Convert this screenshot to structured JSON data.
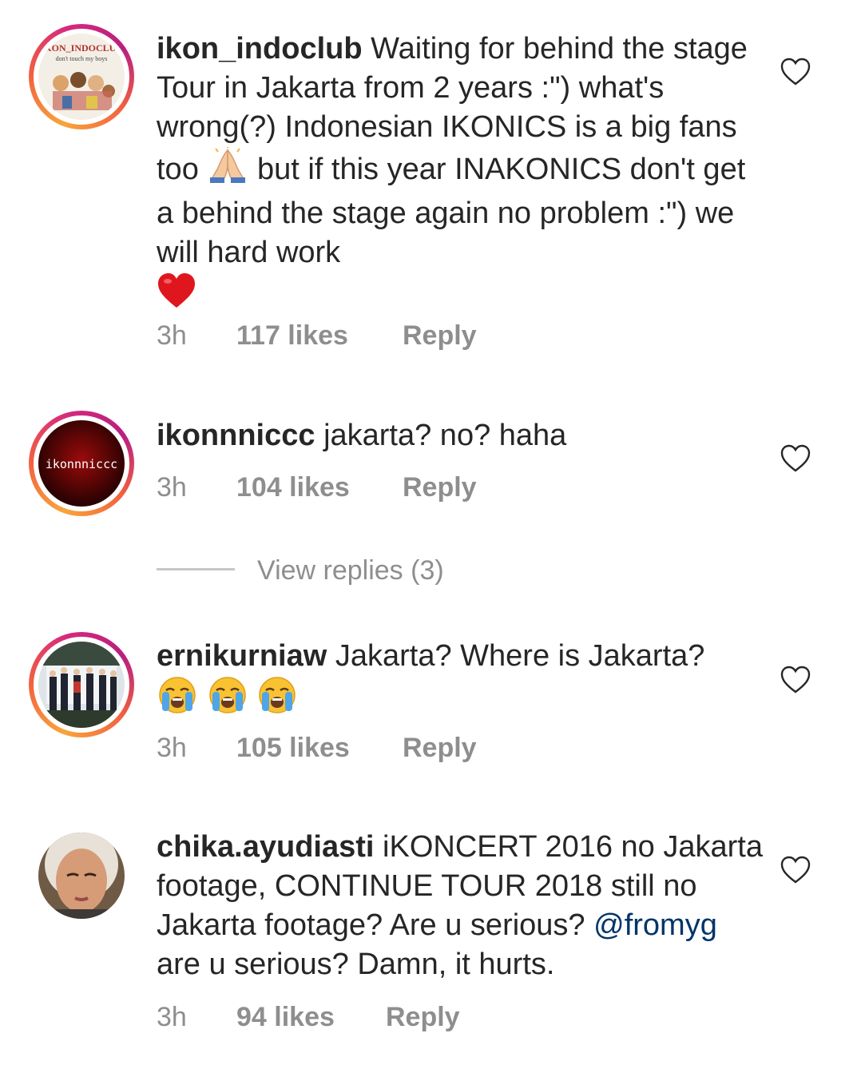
{
  "comments": [
    {
      "username": "ikon_indoclub",
      "text_part1": "Waiting for behind the stage Tour in Jakarta from 2 years :\") what's wrong(?) Indonesian IKONICS is a big fans too",
      "text_part2": "but if this year INAKONICS don't get a behind the stage again no problem :\") we will hard work",
      "emoji_1": "folded-hands",
      "emoji_2": "red-heart",
      "avatar_caption_top": "IKON_INDOCLUB",
      "avatar_caption_bottom": "don't touch my boys",
      "time": "3h",
      "likes": "117 likes",
      "reply": "Reply"
    },
    {
      "username": "ikonnniccc",
      "text": "jakarta? no? haha",
      "avatar_caption": "ikonnniccc",
      "time": "3h",
      "likes": "104 likes",
      "reply": "Reply"
    },
    {
      "username": "ernikurniaw",
      "text": "Jakarta? Where is Jakarta?",
      "emoji": "loudly-crying-face",
      "emoji_count": 3,
      "time": "3h",
      "likes": "105 likes",
      "reply": "Reply"
    },
    {
      "username": "chika.ayudiasti",
      "text_part1": "iKONCERT 2016 no Jakarta footage, CONTINUE TOUR 2018 still no Jakarta footage? Are u serious?",
      "mention": "@fromyg",
      "text_part2": "are u serious? Damn, it hurts.",
      "time": "3h",
      "likes": "94 likes",
      "reply": "Reply"
    }
  ],
  "view_replies": "View replies (3)",
  "colors": {
    "text": "#262626",
    "meta": "#8e8e8e",
    "mention": "#003569",
    "ring_start": "#f9a43b",
    "ring_end": "#d6297e"
  }
}
